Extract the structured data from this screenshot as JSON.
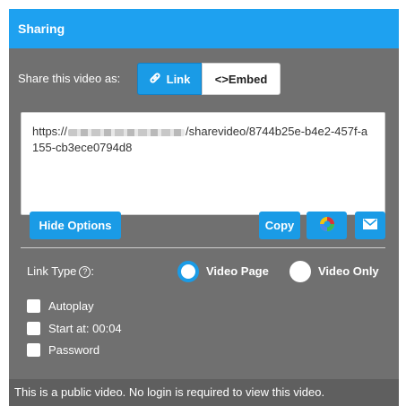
{
  "header": {
    "title": "Sharing"
  },
  "share": {
    "label": "Share this video as:",
    "link_label": "Link",
    "embed_label": "<>Embed"
  },
  "url": {
    "prefix": "https://",
    "suffix": "/sharevideo/8744b25e-b4e2-457f-a155-cb3ece0794d8"
  },
  "actions": {
    "hide_options": "Hide Options",
    "copy": "Copy"
  },
  "options": {
    "link_type_label": "Link Type",
    "link_type_colon": ":",
    "video_page": "Video Page",
    "video_only": "Video Only",
    "selected": "Video Page",
    "autoplay": "Autoplay",
    "start_at": "Start at: 00:04",
    "password": "Password"
  },
  "footer": {
    "text": "This is a public video. No login is required to view this video."
  },
  "colors": {
    "accent": "#1a9be6",
    "header": "#1ea1f0",
    "panel": "#707070"
  }
}
